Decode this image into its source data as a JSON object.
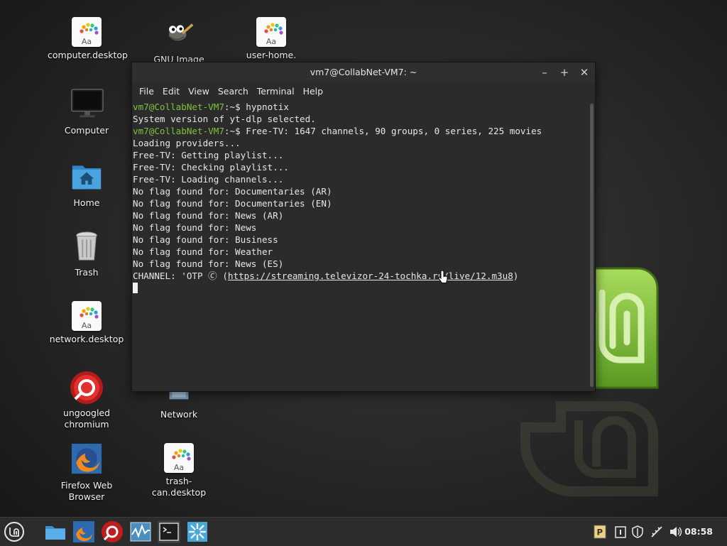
{
  "desktop": {
    "icons": [
      {
        "label": "computer.desktop"
      },
      {
        "label": "GNU Image"
      },
      {
        "label": "user-home."
      },
      {
        "label": "Computer"
      },
      {
        "label": "Home"
      },
      {
        "label": "Trash"
      },
      {
        "label": "network.desktop"
      },
      {
        "label": "ungoogled chromium"
      },
      {
        "label": "Network"
      },
      {
        "label": "Firefox Web Browser"
      },
      {
        "label": "trash-can.desktop"
      }
    ],
    "paint_icon_text": "Aa"
  },
  "terminal": {
    "title": "vm7@CollabNet-VM7: ~",
    "menu": [
      "File",
      "Edit",
      "View",
      "Search",
      "Terminal",
      "Help"
    ],
    "prompt_user": "vm7@CollabNet-VM7",
    "prompt_suffix": ":~$ ",
    "lines": [
      {
        "prompt": true,
        "text": "hypnotix"
      },
      {
        "prompt": false,
        "text": "System version of yt-dlp selected."
      },
      {
        "prompt": true,
        "text": "Free-TV: 1647 channels, 90 groups, 0 series, 225 movies"
      },
      {
        "prompt": false,
        "text": "Loading providers..."
      },
      {
        "prompt": false,
        "text": "Free-TV: Getting playlist..."
      },
      {
        "prompt": false,
        "text": "Free-TV: Checking playlist..."
      },
      {
        "prompt": false,
        "text": "Free-TV: Loading channels..."
      },
      {
        "prompt": false,
        "text": "No flag found for: Documentaries (AR)"
      },
      {
        "prompt": false,
        "text": "No flag found for: Documentaries (EN)"
      },
      {
        "prompt": false,
        "text": "No flag found for: News (AR)"
      },
      {
        "prompt": false,
        "text": "No flag found for: News"
      },
      {
        "prompt": false,
        "text": "No flag found for: Business"
      },
      {
        "prompt": false,
        "text": "No flag found for: Weather"
      },
      {
        "prompt": false,
        "text": "No flag found for: News (ES)"
      }
    ],
    "channel_line": {
      "prefix": "CHANNEL: 'OTP ",
      "mark": "🄫",
      "open": " (",
      "url": "https://streaming.televizor-24-tochka.ru/live/12.m3u8",
      "close": ")"
    }
  },
  "taskbar": {
    "clock": "08:58",
    "apps": [
      "menu-icon",
      "files-icon",
      "firefox-icon",
      "chromium-icon",
      "system-monitor-icon",
      "terminal-icon",
      "hypnotix-icon"
    ],
    "tray": [
      "package-updates-icon",
      "clipboard-icon",
      "shield-icon",
      "network-icon",
      "volume-icon"
    ],
    "accent": "#7ec23b"
  }
}
